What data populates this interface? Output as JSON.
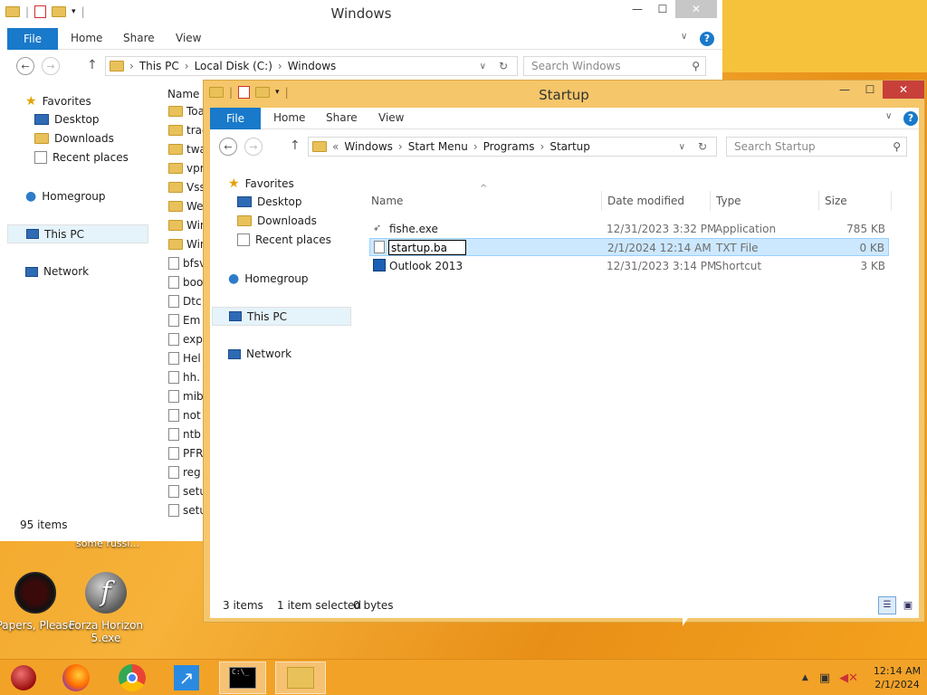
{
  "desktop": {
    "note": "some russi...",
    "icons": [
      {
        "label": "Papers, Please"
      },
      {
        "label": "Forza Horizon 5.exe"
      }
    ]
  },
  "windows_explorer": {
    "title": "Windows",
    "ribbon": {
      "file": "File",
      "home": "Home",
      "share": "Share",
      "view": "View"
    },
    "address": [
      "This PC",
      "Local Disk (C:)",
      "Windows"
    ],
    "search_placeholder": "Search Windows",
    "nav": {
      "favorites": "Favorites",
      "desktop": "Desktop",
      "downloads": "Downloads",
      "recent": "Recent places",
      "homegroup": "Homegroup",
      "this_pc": "This PC",
      "network": "Network"
    },
    "column_name": "Name",
    "items": [
      "Toa",
      "trac",
      "twa",
      "vpr",
      "Vss",
      "We",
      "Win",
      "Win",
      "bfsv",
      "boo",
      "Dtc",
      "Em",
      "exp",
      "Hel",
      "hh.",
      "mib",
      "not",
      "ntb",
      "PFR",
      "reg",
      "setu",
      "setu"
    ],
    "status": "95 items"
  },
  "startup_explorer": {
    "title": "Startup",
    "ribbon": {
      "file": "File",
      "home": "Home",
      "share": "Share",
      "view": "View"
    },
    "address_prefix": "«",
    "address": [
      "Windows",
      "Start Menu",
      "Programs",
      "Startup"
    ],
    "search_placeholder": "Search Startup",
    "nav": {
      "favorites": "Favorites",
      "desktop": "Desktop",
      "downloads": "Downloads",
      "recent": "Recent places",
      "homegroup": "Homegroup",
      "this_pc": "This PC",
      "network": "Network"
    },
    "columns": {
      "name": "Name",
      "date": "Date modified",
      "type": "Type",
      "size": "Size"
    },
    "files": [
      {
        "name": "fishe.exe",
        "date": "12/31/2023 3:32 PM",
        "type": "Application",
        "size": "785 KB"
      },
      {
        "name": "startup.ba",
        "date": "2/1/2024 12:14 AM",
        "type": "TXT File",
        "size": "0 KB"
      },
      {
        "name": "Outlook 2013",
        "date": "12/31/2023 3:14 PM",
        "type": "Shortcut",
        "size": "3 KB"
      }
    ],
    "status": {
      "count": "3 items",
      "selected": "1 item selected",
      "bytes": "0 bytes"
    }
  },
  "taskbar": {
    "time": "12:14 AM",
    "date": "2/1/2024"
  }
}
